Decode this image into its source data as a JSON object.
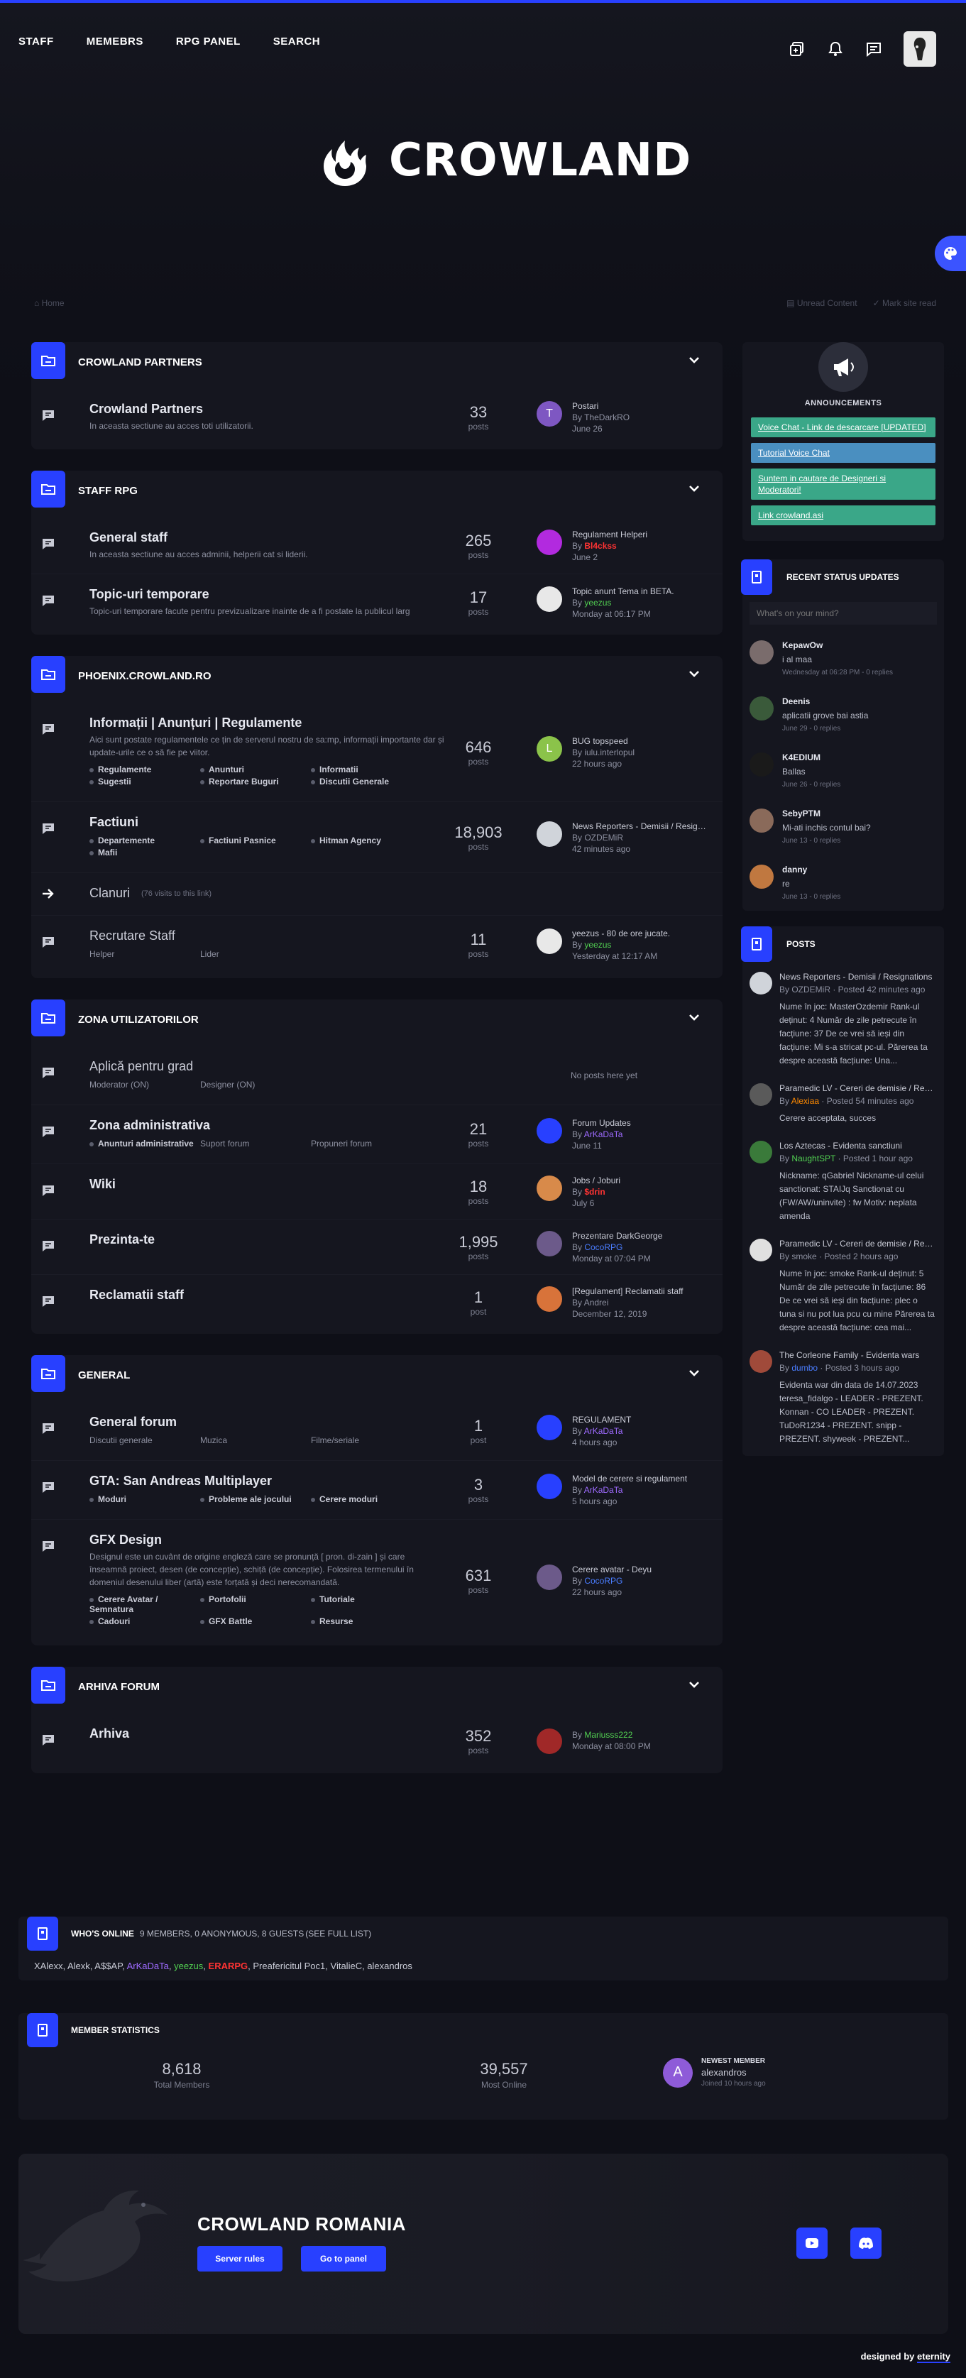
{
  "nav": [
    "STAFF",
    "MEMEBRS",
    "RPG PANEL",
    "SEARCH"
  ],
  "logo_text": "CROWLAND",
  "breadcrumb": "Home",
  "breadcrumb_actions": [
    "Unread Content",
    "Mark site read"
  ],
  "categories": [
    {
      "title": "CROWLAND PARTNERS",
      "forums": [
        {
          "title": "Crowland Partners",
          "desc": "In aceasta sectiune au acces toti utilizatorii.",
          "num": "33",
          "lbl": "posts",
          "last": {
            "title": "Postari",
            "by_prefix": "By ",
            "by": "TheDarkRO",
            "by_class": "",
            "time": "June 26",
            "avatar_letter": "T",
            "avatar_color": "#7e57c2"
          }
        }
      ]
    },
    {
      "title": "STAFF RPG",
      "forums": [
        {
          "title": "General staff",
          "desc": "In aceasta sectiune au acces adminii, helperii cat si liderii.",
          "num": "265",
          "lbl": "posts",
          "last": {
            "title": "Regulament Helperi",
            "by_prefix": "By ",
            "by": "Bl4ckss",
            "by_class": "uname-red",
            "time": "June 2",
            "avatar_letter": "",
            "avatar_color": "#b22adf"
          }
        },
        {
          "title": "Topic-uri temporare",
          "desc": "Topic-uri temporare facute pentru previzualizare inainte de a fi postate la publicul larg",
          "num": "17",
          "lbl": "posts",
          "last": {
            "title": "Topic anunt Tema in BETA.",
            "by_prefix": "By ",
            "by": "yeezus",
            "by_class": "uname-green",
            "time": "Monday at 06:17 PM",
            "avatar_letter": "",
            "avatar_color": "#e8e8e8"
          }
        }
      ]
    },
    {
      "title": "PHOENIX.CROWLAND.RO",
      "forums": [
        {
          "title": "Informații | Anunțuri | Regulamente",
          "desc": "Aici sunt postate regulamentele ce țin de serverul nostru de sa:mp, informații importante dar și update-urile ce o să fie pe viitor.",
          "num": "646",
          "lbl": "posts",
          "subs": [
            "Regulamente",
            "Anunturi",
            "Informatii",
            "Sugestii",
            "Reportare Buguri",
            "Discutii Generale"
          ],
          "last": {
            "title": "BUG topspeed",
            "by_prefix": "By ",
            "by": "iulu.interlopul",
            "by_class": "",
            "time": "22 hours ago",
            "avatar_letter": "L",
            "avatar_color": "#8bc34a"
          }
        },
        {
          "title": "Factiuni",
          "desc": "",
          "num": "18,903",
          "lbl": "posts",
          "subs": [
            "Departemente",
            "Factiuni Pasnice",
            "Hitman Agency",
            "Mafii"
          ],
          "last": {
            "title": "News Reporters - Demisii / Resignations",
            "by_prefix": "By ",
            "by": "OZDEMiR",
            "by_class": "",
            "time": "42 minutes ago",
            "avatar_letter": "",
            "avatar_color": "#d0d4da"
          }
        },
        {
          "title": "Clanuri",
          "redirect": "(76 visits to this link)"
        },
        {
          "title": "Recrutare Staff",
          "desc": "",
          "num": "11",
          "lbl": "posts",
          "subs_plain": [
            "Helper",
            "Lider"
          ],
          "last": {
            "title": "yeezus - 80 de ore jucate.",
            "by_prefix": "By ",
            "by": "yeezus",
            "by_class": "uname-green",
            "time": "Yesterday at 12:17 AM",
            "avatar_letter": "",
            "avatar_color": "#e8e8e8"
          }
        }
      ]
    },
    {
      "title": "ZONA UTILIZATORILOR",
      "forums": [
        {
          "title": "Aplică pentru grad",
          "subs_plain": [
            "Moderator (ON)",
            "Designer (ON)"
          ],
          "noposts": "No posts here yet"
        },
        {
          "title": "Zona administrativa",
          "desc": "",
          "num": "21",
          "lbl": "posts",
          "subs_mixed": [
            {
              "t": "Anunturi administrative",
              "b": true
            },
            {
              "t": "Suport forum",
              "b": false
            },
            {
              "t": "Propuneri forum",
              "b": false
            }
          ],
          "last": {
            "title": "Forum Updates",
            "by_prefix": "By ",
            "by": "ArKaDaTa",
            "by_class": "uname-purple",
            "time": "June 11",
            "avatar_letter": "",
            "avatar_color": "#2840ff"
          }
        },
        {
          "title": "Wiki",
          "desc": "",
          "num": "18",
          "lbl": "posts",
          "last": {
            "title": "Jobs / Joburi",
            "by_prefix": "By ",
            "by": "$drin",
            "by_class": "uname-red",
            "time": "July 6",
            "avatar_letter": "",
            "avatar_color": "#d88a4a"
          }
        },
        {
          "title": "Prezinta-te",
          "desc": "",
          "num": "1,995",
          "lbl": "posts",
          "last": {
            "title": "Prezentare DarkGeorge",
            "by_prefix": "By ",
            "by": "CocoRPG",
            "by_class": "uname-blue",
            "time": "Monday at 07:04 PM",
            "avatar_letter": "",
            "avatar_color": "#6c5a8a"
          }
        },
        {
          "title": "Reclamatii staff",
          "desc": "",
          "num": "1",
          "lbl": "post",
          "last": {
            "title": "[Regulament] Reclamatii staff",
            "by_prefix": "By ",
            "by": "Andrei",
            "by_class": "",
            "time": "December 12, 2019",
            "avatar_letter": "",
            "avatar_color": "#d8733a"
          }
        }
      ]
    },
    {
      "title": "GENERAL",
      "forums": [
        {
          "title": "General forum",
          "desc": "",
          "num": "1",
          "lbl": "post",
          "subs_plain": [
            "Discutii generale",
            "Muzica",
            "Filme/seriale"
          ],
          "last": {
            "title": "REGULAMENT",
            "by_prefix": "By ",
            "by": "ArKaDaTa",
            "by_class": "uname-purple",
            "time": "4 hours ago",
            "avatar_letter": "",
            "avatar_color": "#2840ff"
          }
        },
        {
          "title": "GTA: San Andreas Multiplayer",
          "desc": "",
          "num": "3",
          "lbl": "posts",
          "subs": [
            "Moduri",
            "Probleme ale jocului",
            "Cerere moduri"
          ],
          "last": {
            "title": "Model de cerere si regulament",
            "by_prefix": "By ",
            "by": "ArKaDaTa",
            "by_class": "uname-purple",
            "time": "5 hours ago",
            "avatar_letter": "",
            "avatar_color": "#2840ff"
          }
        },
        {
          "title": "GFX Design",
          "desc": "Designul este un cuvânt de origine engleză care se pronunță [ pron. di-zain ] și care înseamnă proiect, desen (de concepție), schiță (de concepție). Folosirea termenului în domeniul desenului liber (artă) este forțată și deci nerecomandată.",
          "num": "631",
          "lbl": "posts",
          "subs": [
            "Cerere Avatar / Semnatura",
            "Portofolii",
            "Tutoriale",
            "Cadouri",
            "GFX Battle",
            "Resurse"
          ],
          "last": {
            "title": "Cerere avatar - Deyu",
            "by_prefix": "By ",
            "by": "CocoRPG",
            "by_class": "uname-blue",
            "time": "22 hours ago",
            "avatar_letter": "",
            "avatar_color": "#6c5a8a"
          }
        }
      ]
    },
    {
      "title": "ARHIVA FORUM",
      "forums": [
        {
          "title": "Arhiva",
          "desc": "",
          "num": "352",
          "lbl": "posts",
          "last": {
            "title": "",
            "by_prefix": "By ",
            "by": "Mariusss222",
            "by_class": "uname-green",
            "time": "Monday at 08:00 PM",
            "avatar_letter": "",
            "avatar_color": "#a02828"
          }
        }
      ]
    }
  ],
  "announcements": {
    "title": "ANNOUNCEMENTS",
    "items": [
      {
        "text": "Voice Chat - Link de descarcare [UPDATED]",
        "color": "#3aa788"
      },
      {
        "text": "Tutorial Voice Chat",
        "color": "#4a8fc0"
      },
      {
        "text": "Suntem in cautare de Designeri si Moderatori!",
        "color": "#3aa788"
      },
      {
        "text": "Link crowland.asi",
        "color": "#3aa788"
      }
    ]
  },
  "status_updates": {
    "title": "RECENT STATUS UPDATES",
    "placeholder": "What's on your mind?",
    "items": [
      {
        "name": "KepawOw",
        "name_class": "",
        "text": "i al maa",
        "meta": "Wednesday at 06:28 PM - 0 replies",
        "av": "#7a6c6c"
      },
      {
        "name": "Deenis",
        "name_class": "uname-green",
        "text": "aplicatii grove bai astia",
        "meta": "June 29 - 0 replies",
        "av": "#3a5a3a"
      },
      {
        "name": "K4EDIUM",
        "name_class": "",
        "text": "Ballas",
        "meta": "June 26 - 0 replies",
        "av": "#1a1a1a"
      },
      {
        "name": "SebyPTM",
        "name_class": "",
        "text": "Mi-ati inchis contul bai?",
        "meta": "June 13 - 0 replies",
        "av": "#8a6a5a"
      },
      {
        "name": "danny",
        "name_class": "",
        "text": "re",
        "meta": "June 13 - 0 replies",
        "av": "#c07840"
      }
    ]
  },
  "posts": {
    "title": "POSTS",
    "items": [
      {
        "title": "News Reporters - Demisii / Resignations",
        "by": "OZDEMiR",
        "by_class": "",
        "time": " · Posted 42 minutes ago",
        "body": "Nume în joc: MasterOzdemir Rank-ul deținut: 4 Număr de zile petrecute în facțiune: 37 De ce vrei să ieși din facțiune: Mi s-a stricat pc-ul. Părerea ta despre această facțiune: Una...",
        "av": "#d0d4da"
      },
      {
        "title": "Paramedic LV - Cereri de demisie / Resignations",
        "by": "Alexiaa",
        "by_class": "uname-orange",
        "time": " · Posted 54 minutes ago",
        "body": "Cerere acceptata, succes",
        "av": "#5a5a5a"
      },
      {
        "title": "Los Aztecas - Evidenta sanctiuni",
        "by": "NaughtSPT",
        "by_class": "uname-green",
        "time": " · Posted 1 hour ago",
        "body": "Nickname: qGabriel Nickname-ul celui sanctionat: STAIJq Sanctionat cu (FW/AW/uninvite) : fw Motiv: neplata amenda",
        "av": "#3a7a3a"
      },
      {
        "title": "Paramedic LV - Cereri de demisie / Resignations",
        "by": "smoke",
        "by_class": "",
        "time": " · Posted 2 hours ago",
        "body": "Nume în joc: smoke Rank-ul deținut: 5 Număr de zile petrecute în facțiune: 86 De ce vrei să ieși din facțiune: plec o tuna si nu pot lua pcu cu mine Părerea ta despre această facțiune: cea mai...",
        "av": "#e0e0e0"
      },
      {
        "title": "The Corleone Family - Evidenta wars",
        "by": "dumbo",
        "by_class": "uname-blue",
        "time": " · Posted 3 hours ago",
        "body": "Evidenta war din data de 14.07.2023  teresa_fidalgo - LEADER - PREZENT.  Konnan - CO LEADER - PREZENT. TuDoR1234 - PREZENT. snipp - PREZENT.  shyweek - PREZENT...",
        "av": "#a04a3a"
      }
    ]
  },
  "who_online": {
    "title": "WHO'S ONLINE",
    "sub": "9 MEMBERS, 0 ANONYMOUS, 8 GUESTS",
    "link": "(SEE FULL LIST)",
    "users": [
      {
        "name": "XAlexx",
        "cls": ""
      },
      {
        "name": "Alexk",
        "cls": ""
      },
      {
        "name": "A$$AP",
        "cls": ""
      },
      {
        "name": "ArKaDaTa",
        "cls": "uname-purple"
      },
      {
        "name": "yeezus",
        "cls": "uname-green"
      },
      {
        "name": "ERARPG",
        "cls": "uname-red"
      },
      {
        "name": "Preafericitul Poc1",
        "cls": ""
      },
      {
        "name": "VitalieC",
        "cls": ""
      },
      {
        "name": "alexandros",
        "cls": ""
      }
    ]
  },
  "member_stats": {
    "title": "MEMBER STATISTICS",
    "total_num": "8,618",
    "total_lbl": "Total Members",
    "most_num": "39,557",
    "most_lbl": "Most Online",
    "newest_lbl": "NEWEST MEMBER",
    "newest_name": "alexandros",
    "newest_joined": "Joined 10 hours ago",
    "newest_letter": "A"
  },
  "footer": {
    "title": "CROWLAND ROMANIA",
    "btn_rules": "Server rules",
    "btn_panel": "Go to panel",
    "designed_prefix": "designed by ",
    "designed_brand": "eternity"
  },
  "colors": {
    "accent": "#2840ff",
    "bg": "#0e0f17",
    "panel": "#15161f"
  }
}
